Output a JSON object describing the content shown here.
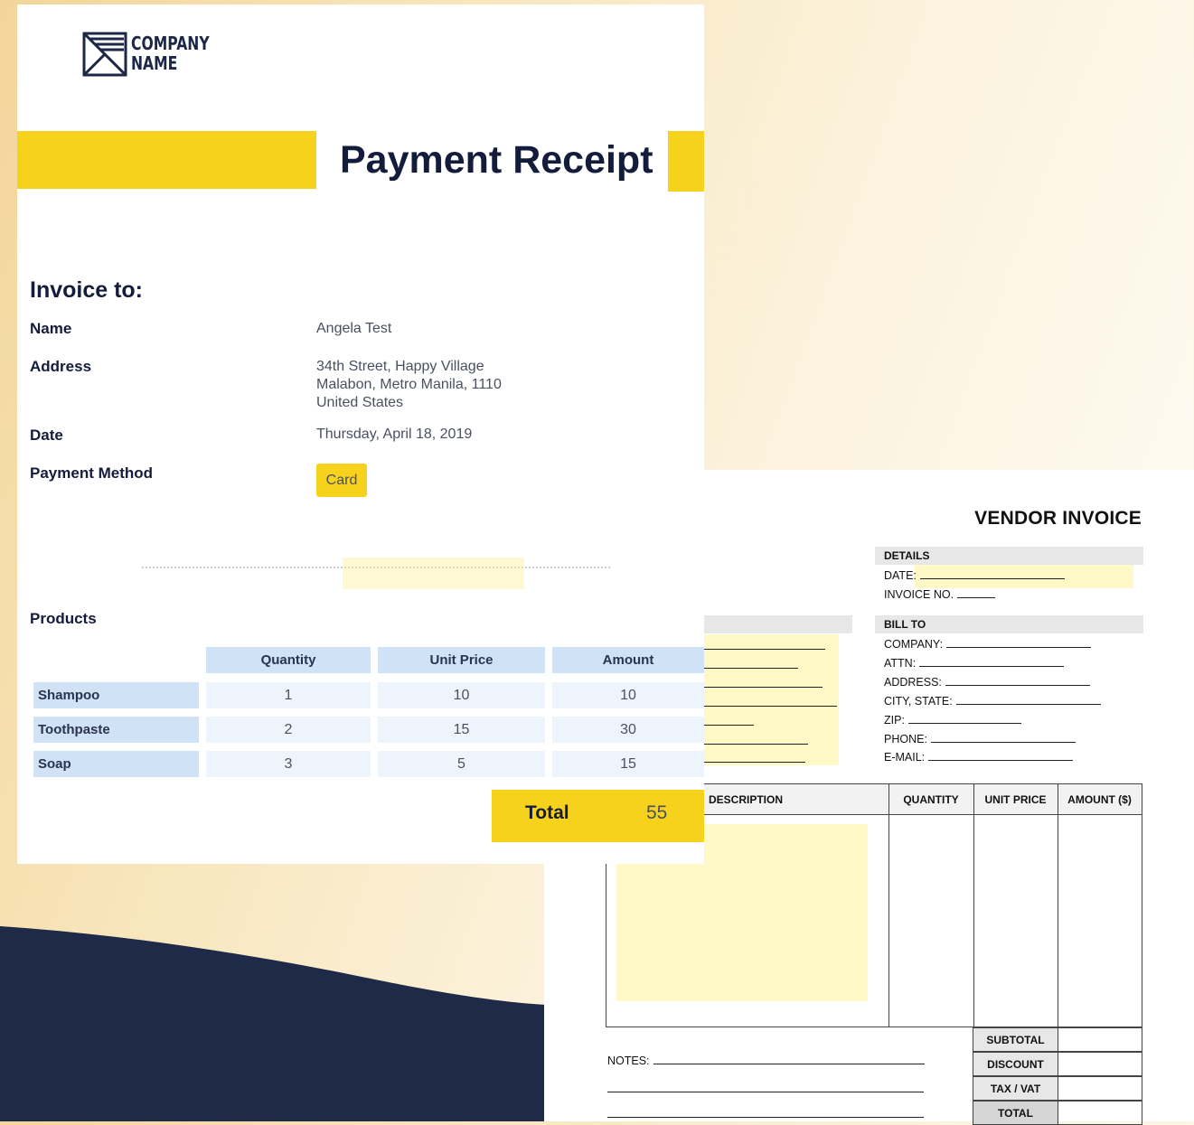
{
  "colors": {
    "accent_yellow": "#f7d21d",
    "navy": "#1e2a47",
    "table_header_blue": "#cfe2f6",
    "table_cell_blue": "#eef4fb"
  },
  "receipt": {
    "logo": {
      "icon": "envelope-logo-icon",
      "line1": "COMPANY",
      "line2": "NAME"
    },
    "title": "Payment Receipt",
    "invoice_to_heading": "Invoice to:",
    "fields": {
      "name_label": "Name",
      "name_value": "Angela Test",
      "address_label": "Address",
      "address_line1": "34th Street, Happy Village",
      "address_line2": "Malabon, Metro Manila, 1110",
      "address_line3": "United States",
      "date_label": "Date",
      "date_value": "Thursday, April 18, 2019",
      "payment_method_label": "Payment Method",
      "payment_method_value": "Card"
    },
    "products_heading": "Products",
    "table": {
      "columns": [
        "Quantity",
        "Unit Price",
        "Amount"
      ],
      "rows": [
        {
          "product": "Shampoo",
          "quantity": "1",
          "unit_price": "10",
          "amount": "10"
        },
        {
          "product": "Toothpaste",
          "quantity": "2",
          "unit_price": "15",
          "amount": "30"
        },
        {
          "product": "Soap",
          "quantity": "3",
          "unit_price": "5",
          "amount": "15"
        }
      ]
    },
    "total_label": "Total",
    "total_value": "55"
  },
  "vendor_invoice": {
    "title": "VENDOR INVOICE",
    "details_heading": "DETAILS",
    "date_label": "DATE:",
    "invoice_no_label": "INVOICE NO.",
    "bill_to_heading": "BILL TO",
    "bill_to_fields": [
      "COMPANY:",
      "ATTN:",
      "ADDRESS:",
      "CITY, STATE:",
      "ZIP:",
      "PHONE:",
      "E-MAIL:"
    ],
    "table_headers": [
      "DESCRIPTION",
      "QUANTITY",
      "UNIT PRICE",
      "AMOUNT ($)"
    ],
    "totals": [
      "SUBTOTAL",
      "DISCOUNT",
      "TAX / VAT",
      "TOTAL"
    ],
    "notes_label": "NOTES:"
  }
}
